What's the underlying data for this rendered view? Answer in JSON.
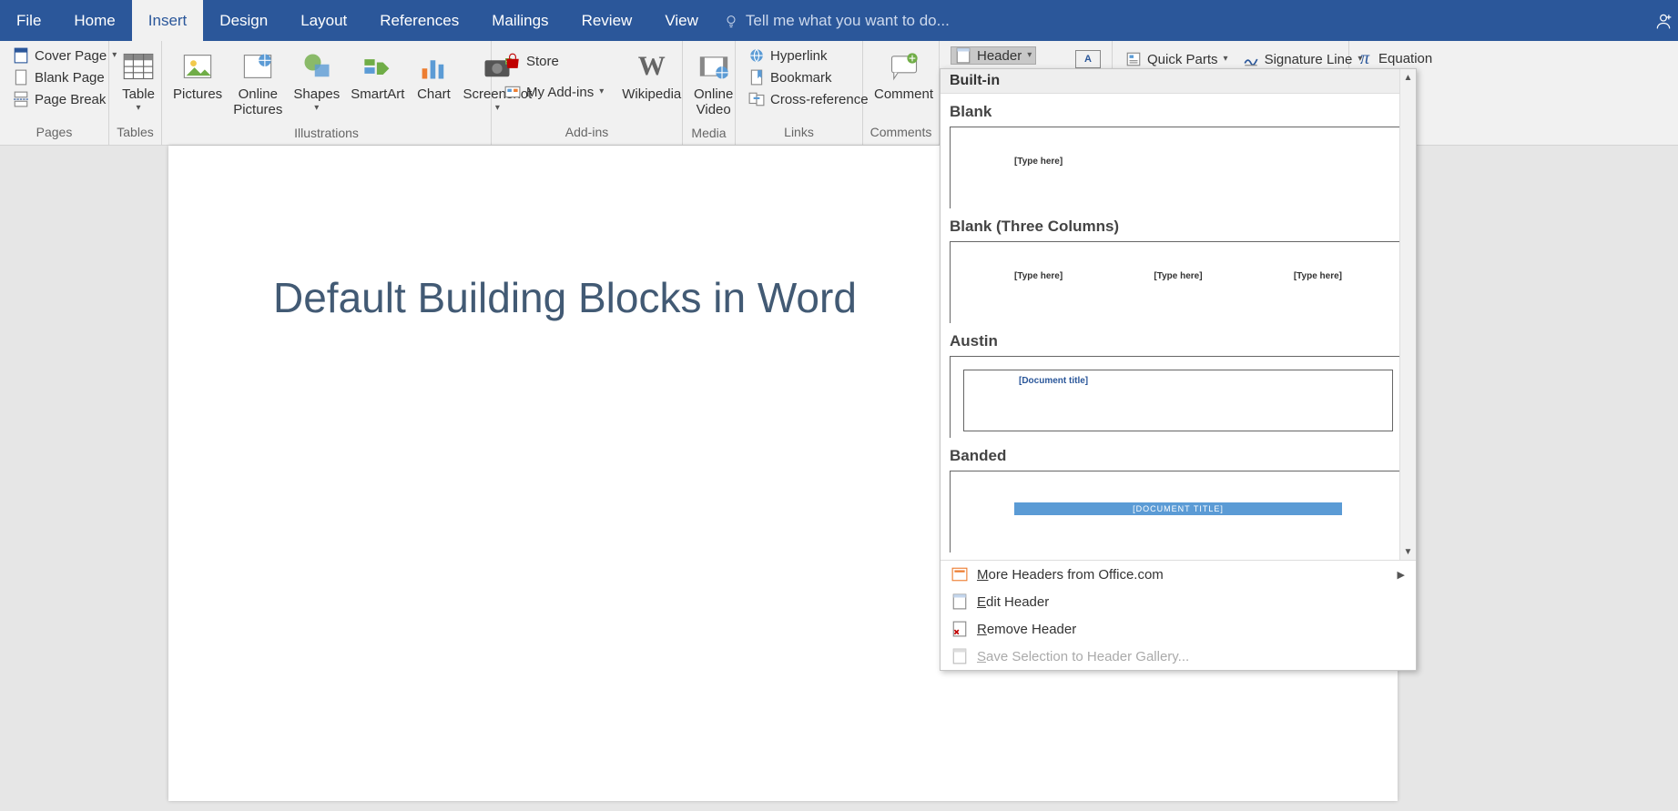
{
  "tabs": {
    "file": "File",
    "home": "Home",
    "insert": "Insert",
    "design": "Design",
    "layout": "Layout",
    "references": "References",
    "mailings": "Mailings",
    "review": "Review",
    "view": "View",
    "tellme": "Tell me what you want to do..."
  },
  "groups": {
    "pages": "Pages",
    "tables": "Tables",
    "illustrations": "Illustrations",
    "addins": "Add-ins",
    "media": "Media",
    "links": "Links",
    "comments": "Comments"
  },
  "pages": {
    "cover": "Cover Page",
    "blank": "Blank Page",
    "break": "Page Break"
  },
  "tables": {
    "table": "Table"
  },
  "illus": {
    "pictures": "Pictures",
    "online": "Online\nPictures",
    "shapes": "Shapes",
    "smartart": "SmartArt",
    "chart": "Chart",
    "screenshot": "Screenshot"
  },
  "addins": {
    "store": "Store",
    "my": "My Add-ins",
    "wiki": "Wikipedia"
  },
  "media": {
    "video": "Online\nVideo"
  },
  "links": {
    "hyper": "Hyperlink",
    "book": "Bookmark",
    "cross": "Cross-reference"
  },
  "comments": {
    "comment": "Comment"
  },
  "hf": {
    "header": "Header"
  },
  "text": {
    "quick": "Quick Parts",
    "sig": "Signature Line"
  },
  "symbols": {
    "eq": "Equation"
  },
  "doc": {
    "title": "Default Building Blocks in Word"
  },
  "gallery": {
    "section": "Built-in",
    "blank": {
      "title": "Blank",
      "ph": "[Type here]"
    },
    "blank3": {
      "title": "Blank (Three Columns)",
      "ph": "[Type here]"
    },
    "austin": {
      "title": "Austin",
      "ph": "[Document title]"
    },
    "banded": {
      "title": "Banded",
      "ph": "[DOCUMENT TITLE]"
    },
    "more": "More Headers from Office.com",
    "edit": "Edit Header",
    "remove": "Remove Header",
    "save": "Save Selection to Header Gallery...",
    "m": "M",
    "e": "E",
    "r": "R",
    "s": "S"
  }
}
